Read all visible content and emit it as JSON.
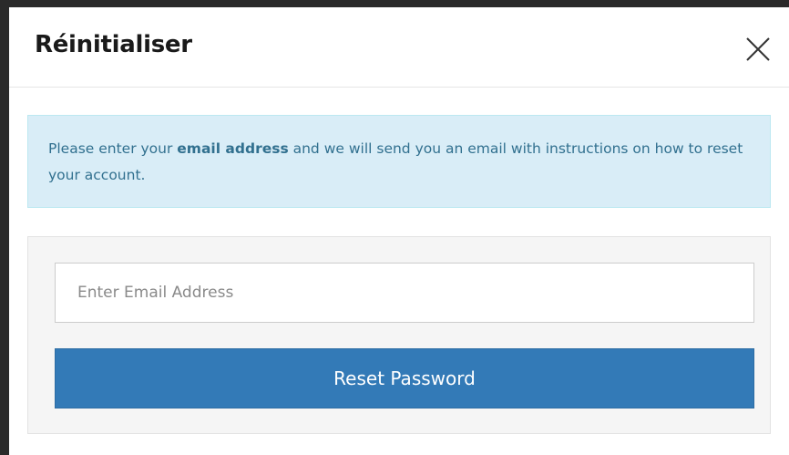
{
  "modal": {
    "title": "Réinitialiser",
    "close_icon": "close-icon"
  },
  "alert": {
    "text_before": "Please enter your ",
    "text_bold": "email address",
    "text_after": " and we will send you an email with instructions on how to reset your account."
  },
  "form": {
    "email_placeholder": "Enter Email Address",
    "email_value": "",
    "submit_label": "Reset Password"
  },
  "colors": {
    "alert_bg": "#d9edf7",
    "alert_text": "#31708f",
    "button_bg": "#337ab7",
    "panel_bg": "#f5f5f5"
  }
}
